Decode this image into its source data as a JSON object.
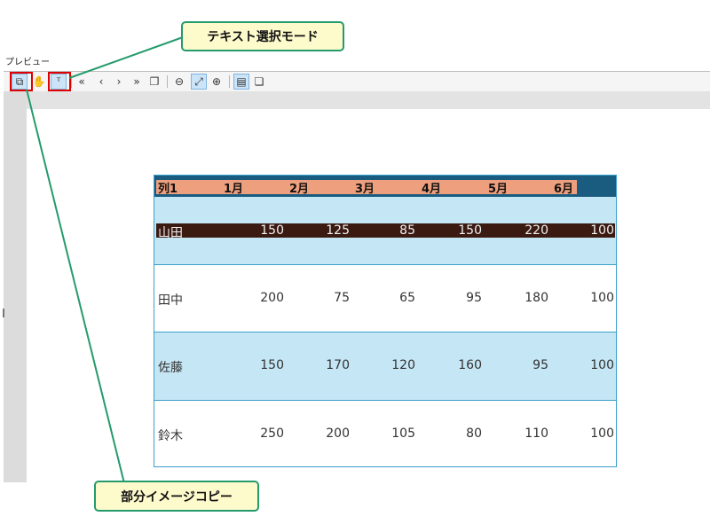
{
  "window": {
    "title": "プレビュー"
  },
  "toolbar": {
    "buttons": [
      {
        "name": "partial-image-copy",
        "glyph": "⧉"
      },
      {
        "name": "hand",
        "glyph": "✋"
      },
      {
        "name": "text-select",
        "glyph": "ᵀ"
      },
      {
        "name": "first-page",
        "glyph": "«"
      },
      {
        "name": "prev-page",
        "glyph": "‹"
      },
      {
        "name": "next-page",
        "glyph": "›"
      },
      {
        "name": "last-page",
        "glyph": "»"
      },
      {
        "name": "copy-pages",
        "glyph": "❐"
      },
      {
        "name": "zoom-out",
        "glyph": "⊖"
      },
      {
        "name": "fit-page",
        "glyph": "⤢"
      },
      {
        "name": "zoom-in",
        "glyph": "⊕"
      },
      {
        "name": "single-page",
        "glyph": "▤"
      },
      {
        "name": "multi-page",
        "glyph": "❏"
      }
    ]
  },
  "callouts": {
    "text_select_mode": "テキスト選択モード",
    "partial_image_copy": "部分イメージコピー"
  },
  "table": {
    "headers": [
      "列1",
      "1月",
      "2月",
      "3月",
      "4月",
      "5月",
      "6月"
    ],
    "rows": [
      {
        "name": "山田",
        "values": [
          "150",
          "125",
          "85",
          "150",
          "220",
          "100"
        ]
      },
      {
        "name": "田中",
        "values": [
          "200",
          "75",
          "65",
          "95",
          "180",
          "100"
        ]
      },
      {
        "name": "佐藤",
        "values": [
          "150",
          "170",
          "120",
          "160",
          "95",
          "100"
        ]
      },
      {
        "name": "鈴木",
        "values": [
          "250",
          "200",
          "105",
          "80",
          "110",
          "100"
        ]
      }
    ]
  },
  "colors": {
    "accent_red": "#e00000",
    "callout_border": "#249b6c",
    "callout_fill": "#fdfacb",
    "header_fill": "#ee9f7d",
    "row_blue": "#c5e6f4",
    "selection": "#3b1a12"
  }
}
